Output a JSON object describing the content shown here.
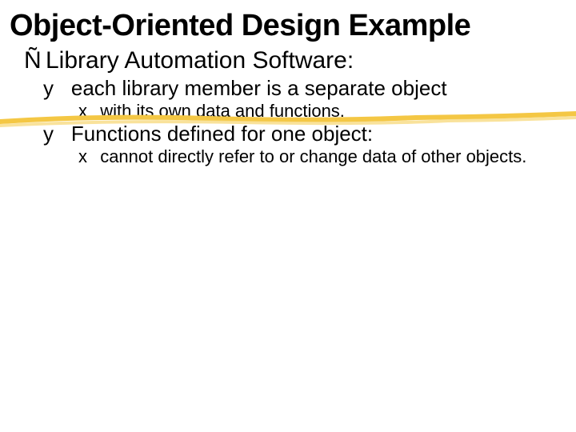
{
  "title": "Object-Oriented Design Example",
  "l1": {
    "bullet": "Ñ",
    "text": "Library Automation Software:"
  },
  "l2a": {
    "bullet": "y",
    "text": "each library member is a separate object"
  },
  "l3a": {
    "bullet": "x",
    "text": "with its own data and functions."
  },
  "l2b": {
    "bullet": "y",
    "text": "Functions defined for one object:"
  },
  "l3b": {
    "bullet": "x",
    "text": "cannot directly refer to or change data of other objects."
  }
}
